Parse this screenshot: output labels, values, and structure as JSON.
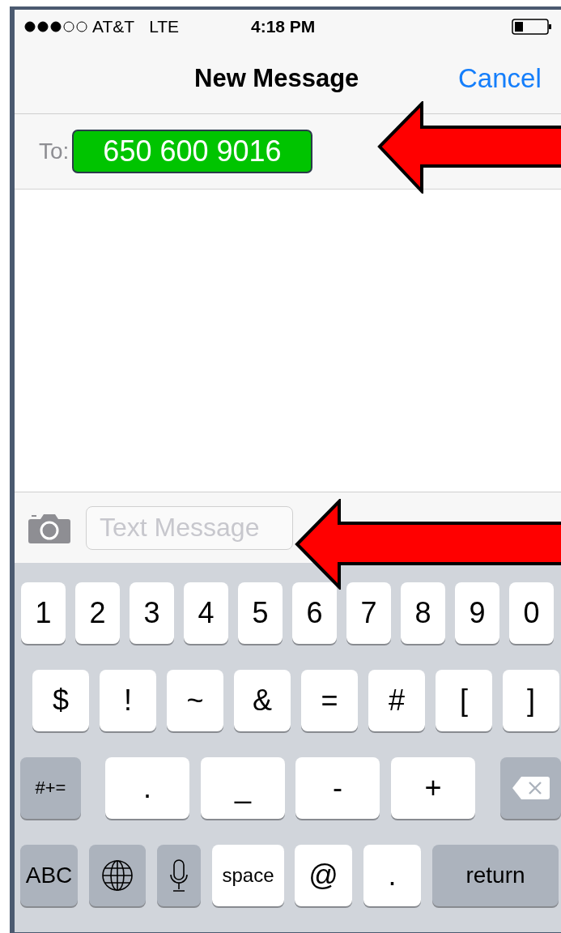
{
  "status_bar": {
    "carrier": "AT&T",
    "network": "LTE",
    "time": "4:18 PM"
  },
  "nav_bar": {
    "title": "New Message",
    "action": "Cancel"
  },
  "recipient": {
    "label": "To:",
    "value": "650 600 9016"
  },
  "compose": {
    "placeholder": "Text Message"
  },
  "keyboard": {
    "rows": [
      {
        "keys": [
          {
            "kind": "key",
            "label": "1"
          },
          {
            "kind": "key",
            "label": "2"
          },
          {
            "kind": "key",
            "label": "3"
          },
          {
            "kind": "key",
            "label": "4"
          },
          {
            "kind": "key",
            "label": "5"
          },
          {
            "kind": "key",
            "label": "6"
          },
          {
            "kind": "key",
            "label": "7"
          },
          {
            "kind": "key",
            "label": "8"
          },
          {
            "kind": "key",
            "label": "9"
          },
          {
            "kind": "key",
            "label": "0"
          }
        ]
      },
      {
        "keys": [
          {
            "kind": "key",
            "label": "$"
          },
          {
            "kind": "key",
            "label": "!"
          },
          {
            "kind": "key",
            "label": "~"
          },
          {
            "kind": "key",
            "label": "&"
          },
          {
            "kind": "key",
            "label": "="
          },
          {
            "kind": "key",
            "label": "#"
          },
          {
            "kind": "key",
            "label": "["
          },
          {
            "kind": "key",
            "label": "]"
          }
        ]
      },
      {
        "keys": [
          {
            "kind": "function",
            "label": "#+="
          },
          {
            "kind": "key",
            "label": "."
          },
          {
            "kind": "key",
            "label": "_"
          },
          {
            "kind": "key",
            "label": "-"
          },
          {
            "kind": "key",
            "label": "+"
          },
          {
            "kind": "delete"
          }
        ]
      },
      {
        "keys": [
          {
            "kind": "function",
            "label": "ABC"
          },
          {
            "kind": "globe"
          },
          {
            "kind": "mic"
          },
          {
            "kind": "key",
            "label": "space"
          },
          {
            "kind": "key",
            "label": "@"
          },
          {
            "kind": "key",
            "label": "."
          },
          {
            "kind": "function",
            "label": "return"
          }
        ]
      }
    ]
  }
}
